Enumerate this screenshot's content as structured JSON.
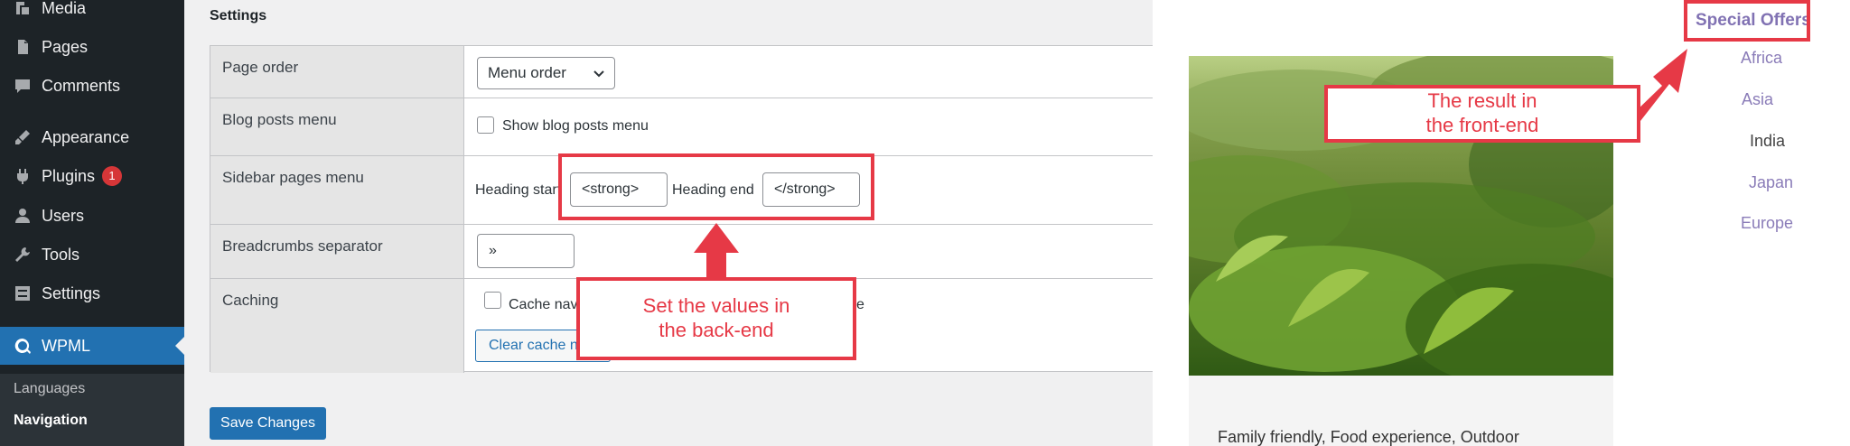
{
  "sidebar": {
    "items": [
      {
        "label": "Media",
        "icon": "media-icon"
      },
      {
        "label": "Pages",
        "icon": "pages-icon"
      },
      {
        "label": "Comments",
        "icon": "comments-icon"
      },
      {
        "label": "Appearance",
        "icon": "appearance-icon"
      },
      {
        "label": "Plugins",
        "icon": "plugins-icon",
        "badge": "1"
      },
      {
        "label": "Users",
        "icon": "users-icon"
      },
      {
        "label": "Tools",
        "icon": "tools-icon"
      },
      {
        "label": "Settings",
        "icon": "settings-icon"
      },
      {
        "label": "WPML",
        "icon": "wpml-icon",
        "active": true
      }
    ],
    "submenu": [
      {
        "label": "Languages"
      },
      {
        "label": "Navigation",
        "current": true
      }
    ]
  },
  "settings": {
    "title": "Settings",
    "rows": {
      "page_order": {
        "label": "Page order",
        "select_value": "Menu order"
      },
      "blog_posts_menu": {
        "label": "Blog posts menu",
        "checkbox_label": "Show blog posts menu",
        "checked": false
      },
      "sidebar_pages_menu": {
        "label": "Sidebar pages menu",
        "heading_start_label": "Heading start",
        "heading_start_value": "<strong>",
        "heading_end_label": "Heading end",
        "heading_end_value": "</strong>"
      },
      "breadcrumbs_separator": {
        "label": "Breadcrumbs separator",
        "value": "»"
      },
      "caching": {
        "label": "Caching",
        "checkbox_label_start": "Cache nav",
        "checkbox_label_end": "e",
        "clear_cache_label": "Clear cache n"
      }
    },
    "save_label": "Save Changes"
  },
  "frontend": {
    "nav": {
      "current": "Special Offers",
      "items": [
        "Africa",
        "Asia",
        "India",
        "Japan",
        "Europe"
      ]
    },
    "caption": "Family friendly, Food experience, Outdoor"
  },
  "callouts": {
    "backend": "Set the values in\nthe back-end",
    "frontend": "The result in\nthe front-end"
  },
  "colors": {
    "sidebar_bg": "#1d2327",
    "accent_blue": "#2271b1",
    "badge_red": "#d63638",
    "annotation_red": "#e63946",
    "nav_purple": "#8172b3"
  }
}
